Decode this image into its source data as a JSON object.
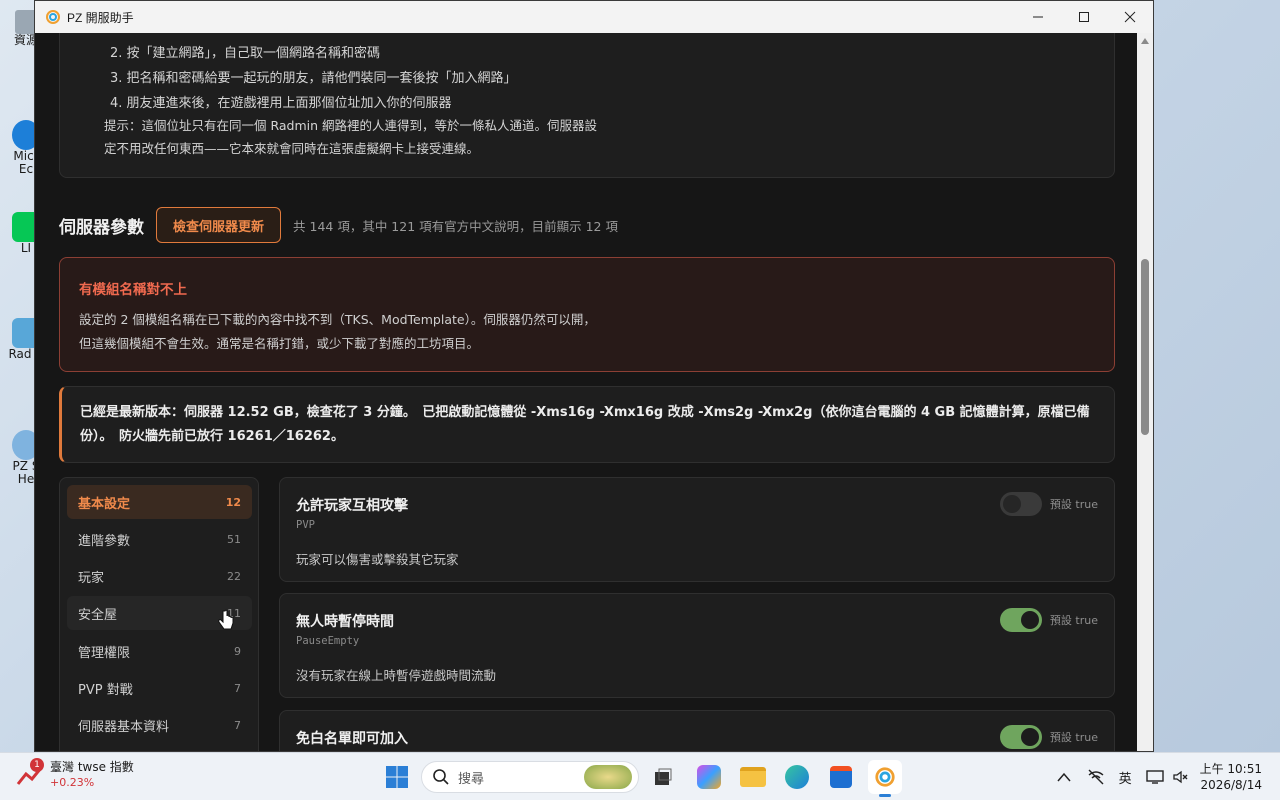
{
  "window": {
    "title": "PZ 開服助手",
    "minimize_icon": "minimize-icon",
    "maximize_icon": "maximize-icon",
    "close_icon": "close-icon"
  },
  "desktop": {
    "icons": [
      {
        "label": "資源",
        "color": "#9aa7b3"
      },
      {
        "label": "Micr Ec",
        "color": "#1d7fd8"
      },
      {
        "label": "LI",
        "color": "#06c755"
      },
      {
        "label": "Rad V",
        "color": "#58a7d8"
      },
      {
        "label": "PZ S He",
        "color": "#7fb3df"
      }
    ]
  },
  "steps": {
    "items": [
      "2. 按「建立網路」，自己取一個網路名稱和密碼",
      "3. 把名稱和密碼給要一起玩的朋友，請他們裝同一套後按「加入網路」",
      "4. 朋友連進來後，在遊戲裡用上面那個位址加入你的伺服器"
    ],
    "tip_line1": "提示：這個位址只有在同一個 Radmin 網路裡的人連得到，等於一條私人通道。伺服器設",
    "tip_line2": "定不用改任何東西——它本來就會同時在這張虛擬網卡上接受連線。"
  },
  "server_params": {
    "title": "伺服器參數",
    "check_button": "檢查伺服器更新",
    "meta": "共 144 項，其中 121 項有官方中文說明，目前顯示 12 項"
  },
  "warning": {
    "title": "有模組名稱對不上",
    "line1": "設定的 2 個模組名稱在已下載的內容中找不到（TKS、ModTemplate）。伺服器仍然可以開，",
    "line2": "但這幾個模組不會生效。通常是名稱打錯，或少下載了對應的工坊項目。"
  },
  "info": {
    "text": "已經是最新版本：伺服器 12.52 GB，檢查花了 3 分鐘。　已把啟動記憶體從 -Xms16g -Xmx16g 改成 -Xms2g -Xmx2g（依你這台電腦的 4 GB 記憶體計算，原檔已備份）。　防火牆先前已放行 16261／16262。"
  },
  "nav": {
    "items": [
      {
        "label": "基本設定",
        "count": "12",
        "active": true
      },
      {
        "label": "進階參數",
        "count": "51"
      },
      {
        "label": "玩家",
        "count": "22"
      },
      {
        "label": "安全屋",
        "count": "11"
      },
      {
        "label": "管理權限",
        "count": "9"
      },
      {
        "label": "PVP 對戰",
        "count": "7"
      },
      {
        "label": "伺服器基本資料",
        "count": "7"
      }
    ]
  },
  "params": [
    {
      "title": "允許玩家互相攻擊",
      "key": "PVP",
      "desc": "玩家可以傷害或擊殺其它玩家",
      "default": "預設 true",
      "on": false
    },
    {
      "title": "無人時暫停時間",
      "key": "PauseEmpty",
      "desc": "沒有玩家在線上時暫停遊戲時間流動",
      "default": "預設 true",
      "on": true
    },
    {
      "title": "免白名單即可加入",
      "key": "",
      "desc": "",
      "default": "預設 true",
      "on": true
    }
  ],
  "taskbar": {
    "widget_title": "臺灣 twse 指數",
    "widget_change": "+0.23%",
    "widget_badge": "1",
    "search_placeholder": "搜尋",
    "ime": "英",
    "time": "上午 10:51",
    "date": "2026/8/14"
  },
  "colors": {
    "accent": "#e07a3c",
    "warning": "#f06a4f",
    "toggle_on": "#6fa55e"
  }
}
